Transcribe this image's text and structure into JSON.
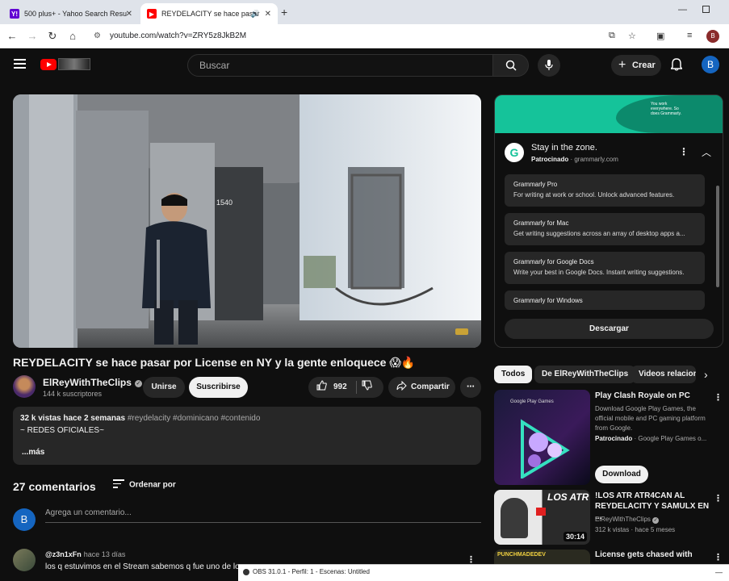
{
  "browser": {
    "tabs": [
      {
        "title": "500 plus+ - Yahoo Search Resu",
        "favicon": "Y!"
      },
      {
        "title": "REYDELACITY se hace pasar"
      }
    ],
    "url": "youtube.com/watch?v=ZRY5z8JkB2M",
    "profile_initial": "B"
  },
  "header": {
    "search_placeholder": "Buscar",
    "create_label": "Crear",
    "avatar_initial": "B"
  },
  "video": {
    "title": "REYDELACITY se hace pasar por License en NY y la gente enloquece 😱🔥",
    "channel": "ElReyWithTheClips",
    "subscribers": "144 k suscriptores",
    "join_label": "Unirse",
    "subscribe_label": "Suscribirse",
    "likes": "992",
    "share_label": "Compartir",
    "scene_sign": "1540"
  },
  "description": {
    "views_date": "32 k vistas  hace 2 semanas",
    "tags": "#reydelacity #dominicano #contenido",
    "line2": "~ REDES OFICIALES~",
    "more": "...más"
  },
  "comments": {
    "count": "27 comentarios",
    "sort_label": "Ordenar por",
    "my_initial": "B",
    "placeholder": "Agrega un comentario...",
    "first": {
      "user": "@z3n1xFn",
      "ago": "hace 13 días",
      "text": "los q estuvimos en el Stream sabemos q fue uno de los"
    }
  },
  "ad": {
    "banner_text": "You work everywhere. So does Grammarly.",
    "logo_letter": "G",
    "title": "Stay in the zone.",
    "sponsored": "Patrocinado",
    "domain": "grammarly.com",
    "cards": [
      {
        "title": "Grammarly Pro",
        "desc": "For writing at work or school. Unlock advanced features."
      },
      {
        "title": "Grammarly for Mac",
        "desc": "Get writing suggestions across an array of desktop apps a..."
      },
      {
        "title": "Grammarly for Google Docs",
        "desc": "Write your best in Google Docs. Instant writing suggestions."
      },
      {
        "title": "Grammarly for Windows",
        "desc": ""
      }
    ],
    "download_label": "Descargar"
  },
  "chips": [
    "Todos",
    "De ElReyWithTheClips",
    "Videos relacion"
  ],
  "recommendations": [
    {
      "title": "Play Clash Royale on PC",
      "desc": "Download Google Play Games, the official mobile and PC gaming platform from Google.",
      "sponsor": "Patrocinado",
      "sponsor_rest": " · Google Play Games o...",
      "thumb_label": "Google Play Games",
      "button": "Download"
    },
    {
      "title": "!LOS ATR ATR4CAN AL REYDELACITY Y SAMULX EN ...",
      "channel": "ElReyWithTheClips",
      "meta": "312 k vistas · hace 5 meses",
      "duration": "30:14",
      "thumb_text": "LOS ATR"
    },
    {
      "title": "License gets chased with",
      "thumb_text": "PUNCHMADEDEV"
    }
  ],
  "obs": {
    "title": "OBS 31.0.1 - Perfil: 1 - Escenas: Untitled"
  }
}
